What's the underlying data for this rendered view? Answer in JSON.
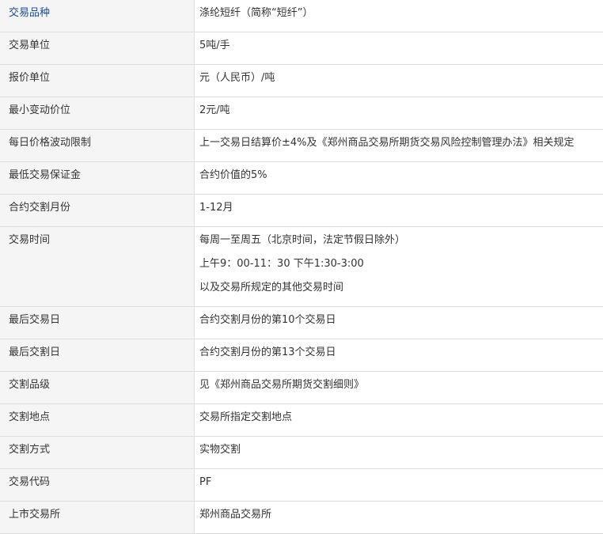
{
  "rows": [
    {
      "label": "交易品种",
      "value": "涤纶短纤（简称“短纤”）"
    },
    {
      "label": "交易单位",
      "value": "5吨/手"
    },
    {
      "label": "报价单位",
      "value": "元（人民币）/吨"
    },
    {
      "label": "最小变动价位",
      "value": "2元/吨"
    },
    {
      "label": "每日价格波动限制",
      "value": "上一交易日结算价±4%及《郑州商品交易所期货交易风险控制管理办法》相关规定"
    },
    {
      "label": "最低交易保证金",
      "value": "合约价值的5%"
    },
    {
      "label": "合约交割月份",
      "value": "1-12月"
    },
    {
      "label": "交易时间",
      "lines": [
        "每周一至周五（北京时间，法定节假日除外）",
        "上午9：00-11：30  下午1:30-3:00",
        "以及交易所规定的其他交易时间"
      ]
    },
    {
      "label": "最后交易日",
      "value": "合约交割月份的第10个交易日"
    },
    {
      "label": "最后交割日",
      "value": "合约交割月份的第13个交易日"
    },
    {
      "label": "交割品级",
      "value": "见《郑州商品交易所期货交割细则》"
    },
    {
      "label": "交割地点",
      "value": "交易所指定交割地点"
    },
    {
      "label": "交割方式",
      "value": "实物交割"
    },
    {
      "label": "交易代码",
      "value": "PF"
    },
    {
      "label": "上市交易所",
      "value": "郑州商品交易所"
    }
  ]
}
